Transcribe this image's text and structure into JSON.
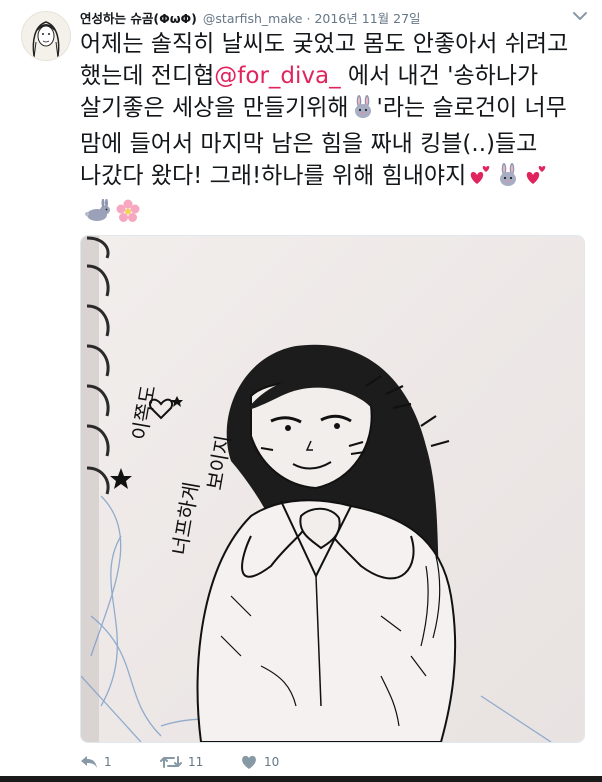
{
  "user": {
    "display_name": "연성하는 슈곰(ΦωΦ)",
    "handle": "@starfish_make",
    "separator": "·",
    "date": "2016년 11월 27일"
  },
  "tweet": {
    "text_1": "어제는 솔직히 날씨도 궂었고 몸도 안좋아서 쉬려고 했는데 전디협",
    "mention": "@for_diva_",
    "text_2": " 에서 내건 '송하나가 살기좋은 세상을 만들기위해",
    "text_3": "'라는 슬로건이 너무 맘에 들어서 마지막 남은 힘을 짜내 킹블(..)들고 나갔다 왔다! 그래!하나를 위해 힘내야지",
    "mention_color": "#e0245e",
    "text_color": "#14171a"
  },
  "media": {
    "drawing_text": [
      "이쪽도",
      "너프하게",
      "보이지"
    ],
    "icon": "sketch-drawing-image"
  },
  "actions": {
    "reply_count": "1",
    "retweet_count": "11",
    "like_count": "10",
    "icon_color": "#8899a6"
  }
}
